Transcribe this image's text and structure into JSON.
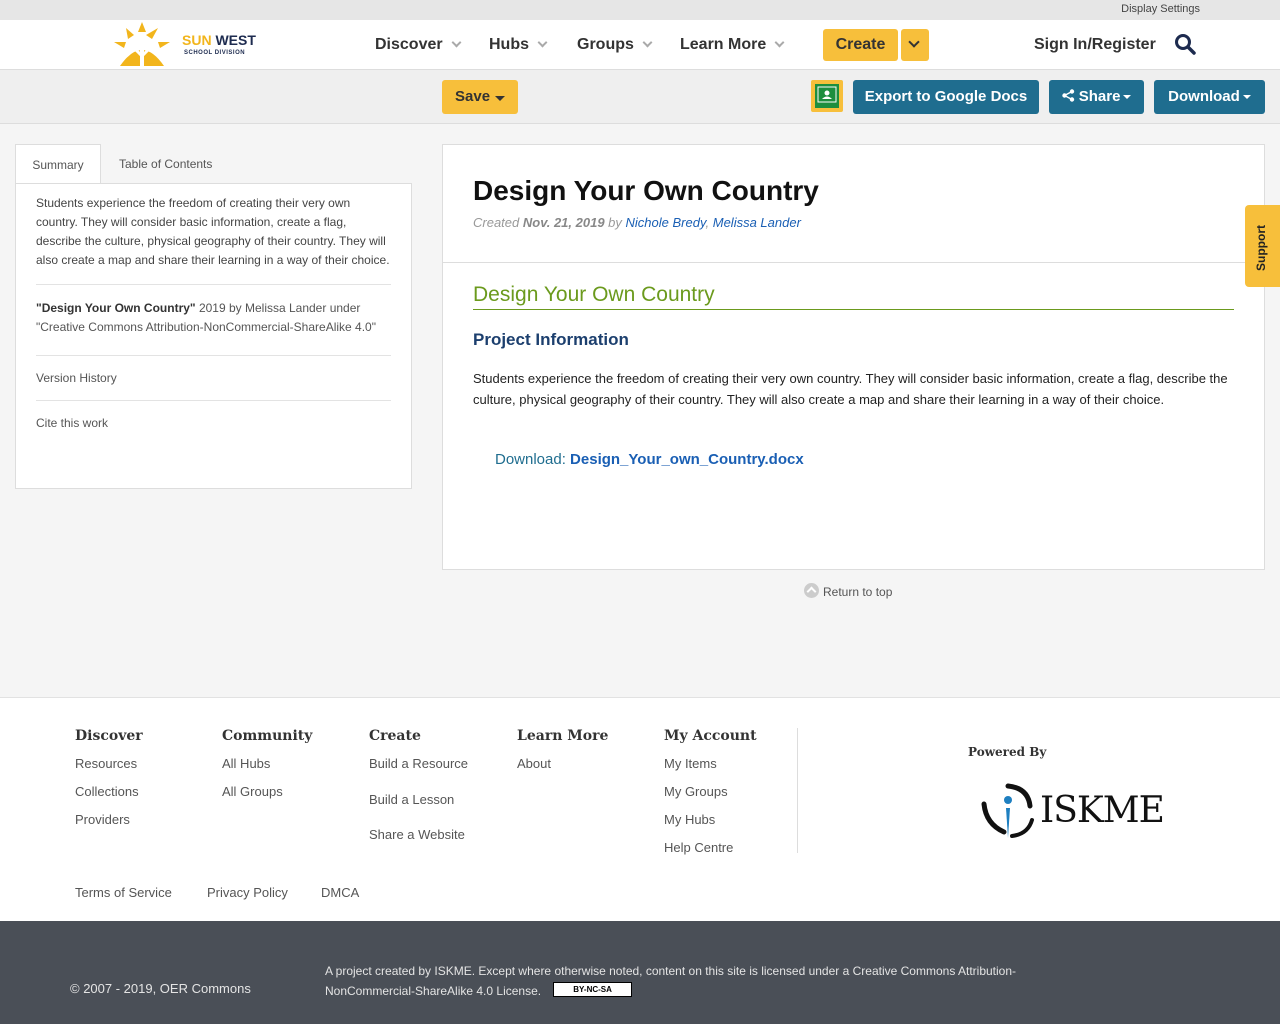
{
  "util": {
    "display_settings": "Display Settings"
  },
  "brand": {
    "sun": "SUN",
    "west": "WEST",
    "sub": "SCHOOL DIVISION"
  },
  "nav": {
    "items": [
      {
        "label": "Discover"
      },
      {
        "label": "Hubs"
      },
      {
        "label": "Groups"
      },
      {
        "label": "Learn More"
      }
    ],
    "create": "Create",
    "signin": "Sign In/Register"
  },
  "actions": {
    "save": "Save",
    "export": "Export to Google Docs",
    "share": "Share",
    "download": "Download"
  },
  "left": {
    "tabs": [
      "Summary",
      "Table of Contents"
    ],
    "summary": "Students experience the freedom of creating their very own country. They will consider basic information, create a flag, describe the culture, physical geography of their country. They will also create a map and share their learning in a way of their choice.",
    "attrib_title": "\"Design Your Own Country\"",
    "attrib_rest": " 2019 by Melissa Lander under \"Creative Commons Attribution-NonCommercial-ShareAlike 4.0\"",
    "version_history": "Version History",
    "cite": "Cite this work"
  },
  "resource": {
    "title": "Design Your Own Country",
    "created_label": "Created",
    "created_date": "Nov. 21, 2019",
    "by": "by",
    "author1": "Nichole Bredy",
    "comma": ",",
    "author2": "Melissa Lander",
    "section_title": "Design Your Own Country",
    "subheading": "Project Information",
    "body": "Students experience the freedom of creating their very own country.   They will consider basic information, create a flag, describe the culture,  physical geography of their country.  They will also create a map and share their learning in a way of their choice.",
    "download_label": "Download: ",
    "download_file": "Design_Your_own_Country.docx"
  },
  "return_top": "Return to top",
  "support": "Support",
  "footer": {
    "columns": [
      {
        "title": "Discover",
        "links": [
          "Resources",
          "Collections",
          "Providers"
        ]
      },
      {
        "title": "Community",
        "links": [
          "All Hubs",
          "All Groups"
        ]
      },
      {
        "title": "Create",
        "links": [
          "Build a Resource",
          "Build a Lesson",
          "Share a Website"
        ]
      },
      {
        "title": "Learn More",
        "links": [
          "About"
        ]
      },
      {
        "title": "My Account",
        "links": [
          "My Items",
          "My Groups",
          "My Hubs",
          "Help Centre"
        ]
      }
    ],
    "powered_by": "Powered By",
    "iskme": "ISKME",
    "legal": [
      "Terms of Service",
      "Privacy Policy",
      "DMCA"
    ],
    "copyright": "© 2007 - 2019, OER Commons",
    "license": "A project created by ISKME. Except where otherwise noted, content on this site is licensed under a Creative Commons Attribution-NonCommercial-ShareAlike 4.0 License.",
    "cc_badge": "BY-NC-SA"
  },
  "colors": {
    "accent_yellow": "#f7bf3b",
    "button_blue": "#1f6d8f",
    "section_green": "#6b9a1d",
    "heading_navy": "#1c3f6e"
  }
}
